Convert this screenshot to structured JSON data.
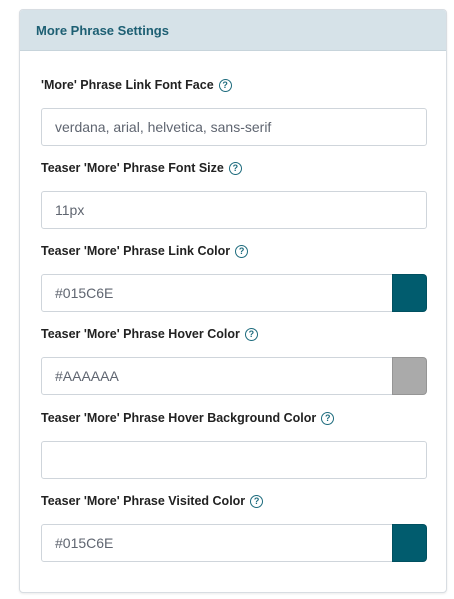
{
  "panel": {
    "title": "More Phrase Settings"
  },
  "help_glyph": "?",
  "fields": [
    {
      "label": "'More' Phrase Link Font Face",
      "value": "verdana, arial, helvetica, sans-serif"
    },
    {
      "label": "Teaser 'More' Phrase Font Size",
      "value": "11px"
    },
    {
      "label": "Teaser 'More' Phrase Link Color",
      "value": "#015C6E",
      "swatch": "#015C6E"
    },
    {
      "label": "Teaser 'More' Phrase Hover Color",
      "value": "#AAAAAA",
      "swatch": "#AAAAAA"
    },
    {
      "label": "Teaser 'More' Phrase Hover Background Color",
      "value": ""
    },
    {
      "label": "Teaser 'More' Phrase Visited Color",
      "value": "#015C6E",
      "swatch": "#015C6E"
    }
  ],
  "colors": {
    "header_bg": "#d6e2e8",
    "header_text": "#1d5f73",
    "help_icon": "#1d6b7d"
  }
}
